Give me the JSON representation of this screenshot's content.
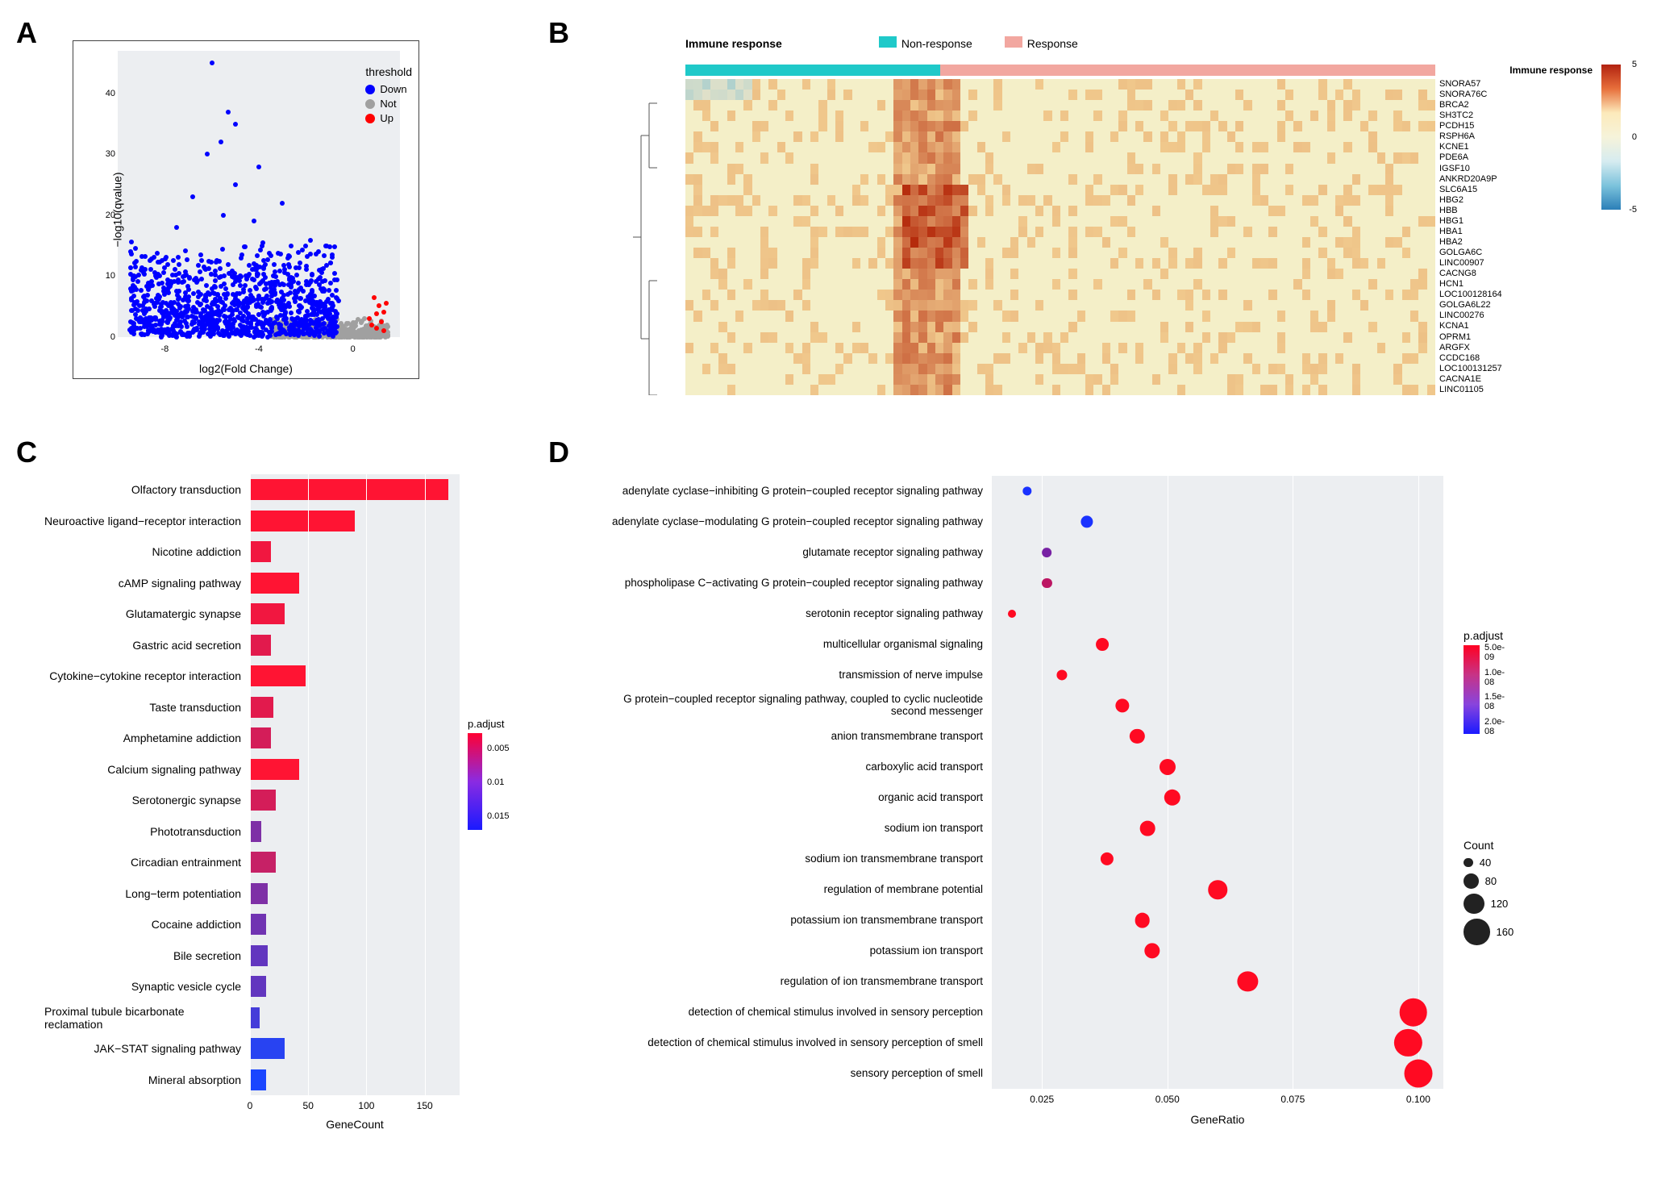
{
  "panels": {
    "A": "A",
    "B": "B",
    "C": "C",
    "D": "D"
  },
  "chart_data": [
    {
      "panel": "A",
      "type": "scatter",
      "title": "",
      "xlabel": "log2(Fold Change)",
      "ylabel": "−log10(qvalue)",
      "xlim": [
        -10,
        2
      ],
      "ylim": [
        0,
        47
      ],
      "xticks": [
        -8,
        -4,
        0
      ],
      "yticks": [
        0,
        10,
        20,
        30,
        40
      ],
      "legend_title": "threshold",
      "legend": [
        {
          "name": "Down",
          "color": "#0000ff"
        },
        {
          "name": "Not",
          "color": "#a0a0a0"
        },
        {
          "name": "Up",
          "color": "#ff0000"
        }
      ],
      "note": "Dense volcano plot; vast majority of significant points are Down (blue), a small cluster of Up (red) near log2FC ≈ +1, large Not-significant cloud (grey) near y≈0."
    },
    {
      "panel": "B",
      "type": "heatmap",
      "title": "",
      "annotation": {
        "label": "Immune response",
        "groups": [
          {
            "name": "Non-response",
            "color": "#1fc9c9",
            "fraction": 0.34
          },
          {
            "name": "Response",
            "color": "#f2a7a0",
            "fraction": 0.66
          }
        ]
      },
      "row_labels": [
        "SNORA57",
        "SNORA76C",
        "BRCA2",
        "SH3TC2",
        "PCDH15",
        "RSPH6A",
        "KCNE1",
        "PDE6A",
        "IGSF10",
        "ANKRD20A9P",
        "SLC6A15",
        "HBG2",
        "HBB",
        "HBG1",
        "HBA1",
        "HBA2",
        "GOLGA6C",
        "LINC00907",
        "CACNG8",
        "HCN1",
        "LOC100128164",
        "GOLGA6L22",
        "LINC00276",
        "KCNA1",
        "OPRM1",
        "ARGFX",
        "CCDC168",
        "LOC100131257",
        "CACNA1E",
        "LINC01105"
      ],
      "colorscale": {
        "min": -5,
        "max": 5,
        "ticks": [
          -5,
          0,
          5
        ],
        "colors": [
          "#2b7fb8",
          "#d6ecf0",
          "#f6f3da",
          "#e76f3b",
          "#b22210"
        ]
      },
      "note": "Rows are genes, columns are samples grouped by immune response; visually higher expression (red/orange) concentrated at the Non-response/Response boundary for HBB-family genes."
    },
    {
      "panel": "C",
      "type": "bar",
      "xlabel": "GeneCount",
      "categories": [
        "Olfactory transduction",
        "Neuroactive ligand−receptor interaction",
        "Nicotine addiction",
        "cAMP signaling pathway",
        "Glutamatergic synapse",
        "Gastric acid secretion",
        "Cytokine−cytokine receptor interaction",
        "Taste transduction",
        "Amphetamine addiction",
        "Calcium signaling pathway",
        "Serotonergic synapse",
        "Phototransduction",
        "Circadian entrainment",
        "Long−term potentiation",
        "Cocaine addiction",
        "Bile secretion",
        "Synaptic vesicle cycle",
        "Proximal tubule bicarbonate reclamation",
        "JAK−STAT signaling pathway",
        "Mineral absorption"
      ],
      "values": [
        170,
        90,
        18,
        42,
        30,
        18,
        48,
        20,
        18,
        42,
        22,
        10,
        22,
        15,
        14,
        15,
        14,
        8,
        30,
        14
      ],
      "padjust": [
        0.001,
        0.001,
        0.002,
        0.001,
        0.002,
        0.003,
        0.001,
        0.003,
        0.004,
        0.001,
        0.004,
        0.01,
        0.005,
        0.01,
        0.011,
        0.012,
        0.012,
        0.014,
        0.016,
        0.017
      ],
      "xlim": [
        0,
        180
      ],
      "xticks": [
        0,
        50,
        100,
        150
      ],
      "color_legend": {
        "title": "p.adjust",
        "ticks": [
          0.005,
          0.01,
          0.015
        ]
      }
    },
    {
      "panel": "D",
      "type": "scatter",
      "xlabel": "GeneRatio",
      "xlim": [
        0.015,
        0.105
      ],
      "xticks": [
        0.025,
        0.05,
        0.075,
        0.1
      ],
      "categories": [
        "adenylate cyclase−inhibiting G protein−coupled receptor signaling pathway",
        "adenylate cyclase−modulating G protein−coupled receptor signaling pathway",
        "glutamate receptor signaling pathway",
        "phospholipase C−activating G protein−coupled receptor signaling pathway",
        "serotonin receptor signaling pathway",
        "multicellular organismal signaling",
        "transmission of nerve impulse",
        "G protein−coupled receptor signaling pathway, coupled to cyclic nucleotide second messenger",
        "anion transmembrane transport",
        "carboxylic acid transport",
        "organic acid transport",
        "sodium ion transport",
        "sodium ion transmembrane transport",
        "regulation of membrane potential",
        "potassium ion transmembrane transport",
        "potassium ion transport",
        "regulation of ion transmembrane transport",
        "detection of chemical stimulus involved in sensory perception",
        "detection of chemical stimulus involved in sensory perception of smell",
        "sensory perception of smell"
      ],
      "gene_ratio": [
        0.022,
        0.034,
        0.026,
        0.026,
        0.019,
        0.037,
        0.029,
        0.041,
        0.044,
        0.05,
        0.051,
        0.046,
        0.038,
        0.06,
        0.045,
        0.047,
        0.066,
        0.099,
        0.098,
        0.1
      ],
      "count": [
        38,
        60,
        40,
        42,
        30,
        64,
        48,
        72,
        78,
        88,
        90,
        80,
        66,
        108,
        80,
        84,
        118,
        172,
        170,
        174
      ],
      "padjust": [
        2e-08,
        2e-08,
        1.3e-08,
        8e-09,
        3e-09,
        3e-09,
        3e-09,
        3e-09,
        3e-09,
        3e-09,
        3e-09,
        3e-09,
        3e-09,
        3e-09,
        3e-09,
        3e-09,
        3e-09,
        3e-09,
        3e-09,
        3e-09
      ],
      "color_legend": {
        "title": "p.adjust",
        "ticks": [
          "5.0e-09",
          "1.0e-08",
          "1.5e-08",
          "2.0e-08"
        ]
      },
      "size_legend": {
        "title": "Count",
        "ticks": [
          40,
          80,
          120,
          160
        ]
      }
    }
  ]
}
